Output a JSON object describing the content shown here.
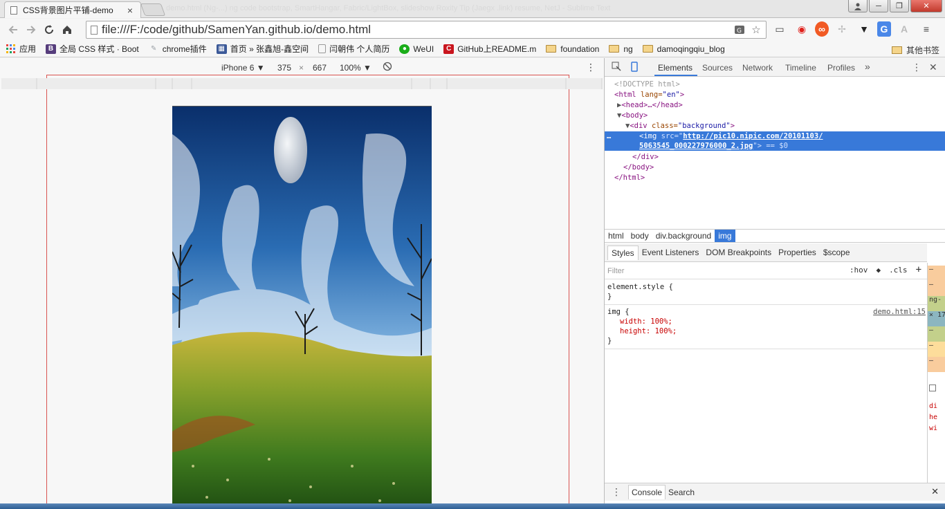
{
  "browser": {
    "tab_title": "CSS背景图片平铺-demo",
    "tab_close": "×",
    "background_title": "demo.html (Ng-...) ng code bootstrap, SmartHangar, Fabric/LightBox, slideshow Roxity Tip (Jaegx .link) resume, NetJ - Sublime Text",
    "window_buttons": {
      "minimize": "─",
      "maximize": "❐",
      "close": "✕"
    },
    "url": "file:///F:/code/github/SamenYan.github.io/demo.html"
  },
  "bookmarks": {
    "items": [
      {
        "label": "应用",
        "icon": "apps-grid-icon",
        "color": "#e8453c"
      },
      {
        "label": "全局 CSS 样式 · Boot",
        "icon": "bootstrap-icon",
        "color": "#563d7c",
        "glyph": "B"
      },
      {
        "label": "chrome插件",
        "icon": "chrome-plugin-icon",
        "color": "#9aa0a6"
      },
      {
        "label": "首页 » 张鑫旭-鑫空间",
        "icon": "zxx-icon",
        "color": "#3b5998"
      },
      {
        "label": "闫朝伟 个人简历",
        "icon": "page-icon",
        "color": "#bbbbbb"
      },
      {
        "label": "WeUI",
        "icon": "wechat-icon",
        "color": "#1aad19"
      },
      {
        "label": "GitHub上README.m",
        "icon": "csdn-icon",
        "color": "#c9151e",
        "glyph": "C"
      },
      {
        "label": "foundation",
        "icon": "folder-icon"
      },
      {
        "label": "ng",
        "icon": "folder-icon"
      },
      {
        "label": "damoqingqiu_blog",
        "icon": "folder-icon"
      }
    ],
    "other": "其他书签"
  },
  "device_toolbar": {
    "device": "iPhone 6",
    "width": "375",
    "times": "×",
    "height": "667",
    "zoom": "100%"
  },
  "devtools": {
    "tabs": [
      "Elements",
      "Sources",
      "Network",
      "Timeline",
      "Profiles"
    ],
    "active_tab": "Elements",
    "more": "»",
    "dom": {
      "doctype": "<!DOCTYPE html>",
      "html_open_tag": "<html",
      "html_attr": " lang=",
      "html_val": "\"en\"",
      "gt": ">",
      "head": "<head>…</head>",
      "body_open": "<body>",
      "div_open_tag": "<div",
      "div_attr": " class=",
      "div_val": "\"background\"",
      "img_tag": "<img",
      "img_attr": " src=\"",
      "img_src_1": "http://pic10.nipic.com/20101103/",
      "img_src_2": "5063545_000227976000_2.jpg",
      "img_end": "\"> == $0",
      "ellipsis": "…",
      "div_close": "</div>",
      "body_close": "</body>",
      "html_close": "</html>"
    },
    "breadcrumbs": [
      "html",
      "body",
      "div.background",
      "img"
    ],
    "subtabs": [
      "Styles",
      "Event Listeners",
      "DOM Breakpoints",
      "Properties",
      "$scope"
    ],
    "filter_placeholder": "Filter",
    "filter_tools": {
      "hov": ":hov",
      "cls": ".cls",
      "add": "+"
    },
    "rules": {
      "element_style": "element.style {",
      "close": "}",
      "img_selector": "img {",
      "img_source": "demo.html:15",
      "decl_1": "width: 100%;",
      "decl_2": "height: 100%;"
    },
    "boxmodel_fragments": [
      "–",
      "–",
      "ng-",
      "× 17",
      "–",
      "–",
      "–",
      "di",
      "he",
      "wi"
    ],
    "drawer": {
      "console": "Console",
      "search": "Search"
    }
  },
  "colors": {
    "selection": "#3879d9",
    "frame_border": "#d9534f"
  }
}
